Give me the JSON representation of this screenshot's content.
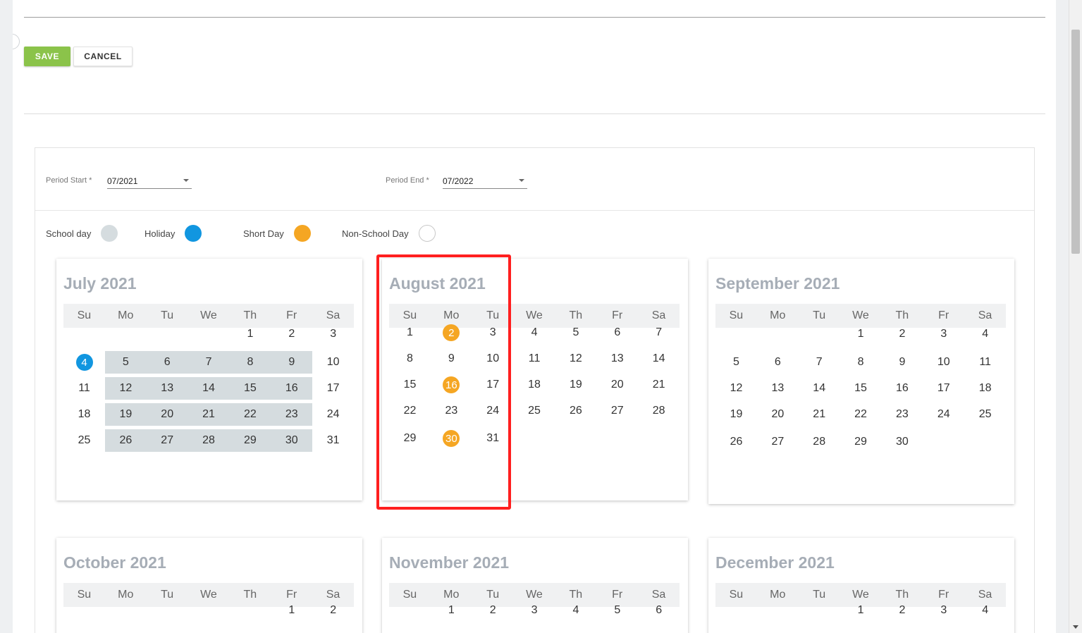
{
  "toolbar": {
    "save_label": "SAVE",
    "cancel_label": "CANCEL"
  },
  "period": {
    "start_label": "Period Start *",
    "start_value": "07/2021",
    "end_label": "Period End *",
    "end_value": "07/2022"
  },
  "legend": [
    {
      "label": "School day",
      "color": "#d5dcdf",
      "key": "school"
    },
    {
      "label": "Holiday",
      "color": "#1196e0",
      "key": "holiday"
    },
    {
      "label": "Short Day",
      "color": "#f5a623",
      "key": "short"
    },
    {
      "label": "Non-School Day",
      "color": "#ffffff",
      "key": "none"
    }
  ],
  "weekdays": [
    "Su",
    "Mo",
    "Tu",
    "We",
    "Th",
    "Fr",
    "Sa"
  ],
  "months": [
    {
      "title": "July 2021",
      "weeks": [
        [
          "",
          "",
          "",
          "",
          "1",
          "2",
          "3"
        ],
        [
          "4",
          "5",
          "6",
          "7",
          "8",
          "9",
          "10"
        ],
        [
          "11",
          "12",
          "13",
          "14",
          "15",
          "16",
          "17"
        ],
        [
          "18",
          "19",
          "20",
          "21",
          "22",
          "23",
          "24"
        ],
        [
          "25",
          "26",
          "27",
          "28",
          "29",
          "30",
          "31"
        ]
      ],
      "school_days": [
        "5",
        "6",
        "7",
        "8",
        "9",
        "12",
        "13",
        "14",
        "15",
        "16",
        "19",
        "20",
        "21",
        "22",
        "23",
        "26",
        "27",
        "28",
        "29",
        "30"
      ],
      "holidays": [
        "4"
      ],
      "short_days": []
    },
    {
      "title": "August 2021",
      "weeks": [
        [
          "1",
          "2",
          "3",
          "4",
          "5",
          "6",
          "7"
        ],
        [
          "8",
          "9",
          "10",
          "11",
          "12",
          "13",
          "14"
        ],
        [
          "15",
          "16",
          "17",
          "18",
          "19",
          "20",
          "21"
        ],
        [
          "22",
          "23",
          "24",
          "25",
          "26",
          "27",
          "28"
        ],
        [
          "29",
          "30",
          "31",
          "",
          "",
          "",
          ""
        ]
      ],
      "school_days": [],
      "holidays": [],
      "short_days": [
        "2",
        "16",
        "30"
      ]
    },
    {
      "title": "September 2021",
      "weeks": [
        [
          "",
          "",
          "",
          "1",
          "2",
          "3",
          "4"
        ],
        [
          "5",
          "6",
          "7",
          "8",
          "9",
          "10",
          "11"
        ],
        [
          "12",
          "13",
          "14",
          "15",
          "16",
          "17",
          "18"
        ],
        [
          "19",
          "20",
          "21",
          "22",
          "23",
          "24",
          "25"
        ],
        [
          "26",
          "27",
          "28",
          "29",
          "30",
          "",
          ""
        ]
      ],
      "school_days": [],
      "holidays": [],
      "short_days": []
    },
    {
      "title": "October 2021",
      "weeks": [
        [
          "",
          "",
          "",
          "",
          "",
          "1",
          "2"
        ]
      ],
      "school_days": [],
      "holidays": [],
      "short_days": []
    },
    {
      "title": "November 2021",
      "weeks": [
        [
          "",
          "1",
          "2",
          "3",
          "4",
          "5",
          "6"
        ]
      ],
      "school_days": [],
      "holidays": [],
      "short_days": []
    },
    {
      "title": "December 2021",
      "weeks": [
        [
          "",
          "",
          "",
          "1",
          "2",
          "3",
          "4"
        ]
      ],
      "school_days": [],
      "holidays": [],
      "short_days": []
    }
  ]
}
